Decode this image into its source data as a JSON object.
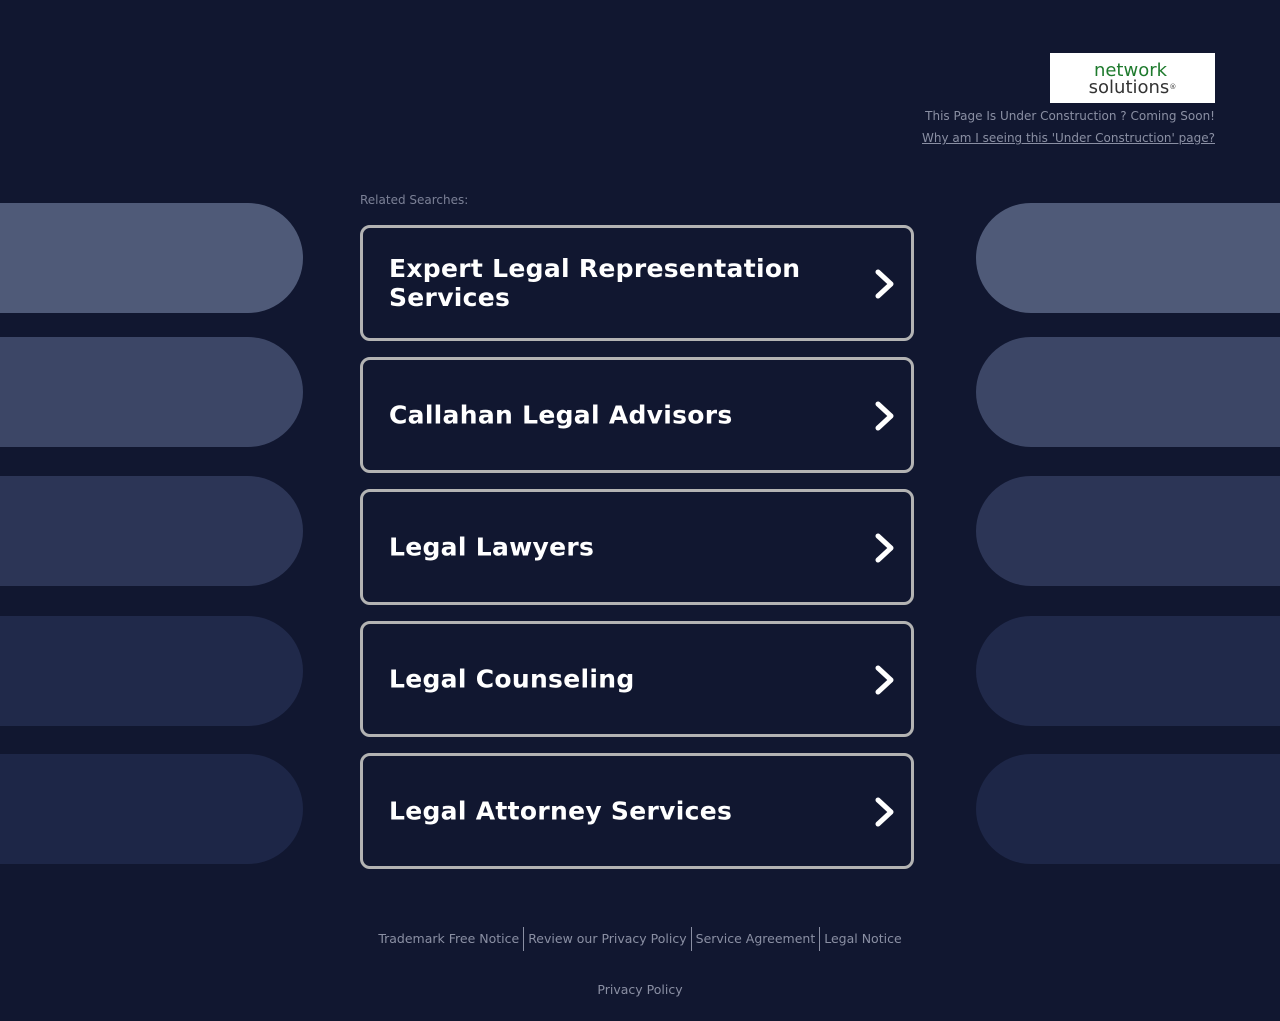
{
  "header": {
    "logo": {
      "line1": "network",
      "line2": "solutions",
      "reg_mark": "®"
    },
    "under_construction_text": "This Page Is Under Construction ? Coming Soon!",
    "why_link": "Why am I seeing this 'Under Construction' page?"
  },
  "main": {
    "related_label": "Related Searches:",
    "items": [
      {
        "label": "Expert Legal Representation Services"
      },
      {
        "label": "Callahan Legal Advisors"
      },
      {
        "label": "Legal Lawyers"
      },
      {
        "label": "Legal Counseling"
      },
      {
        "label": "Legal Attorney Services"
      }
    ]
  },
  "footer": {
    "links": [
      {
        "label": "Trademark Free Notice"
      },
      {
        "label": "Review our Privacy Policy"
      },
      {
        "label": "Service Agreement"
      },
      {
        "label": "Legal Notice"
      }
    ],
    "privacy": "Privacy Policy"
  },
  "colors": {
    "background": "#111730",
    "pill_1": "#4f5a78",
    "pill_2": "#3c4666",
    "pill_3": "#2c3556",
    "pill_4": "#20294a",
    "pill_5": "#1d2647",
    "item_border": "#b3b3b3",
    "logo_green": "#1e7a2d"
  },
  "icons": {
    "chevron": "chevron-right-icon"
  }
}
